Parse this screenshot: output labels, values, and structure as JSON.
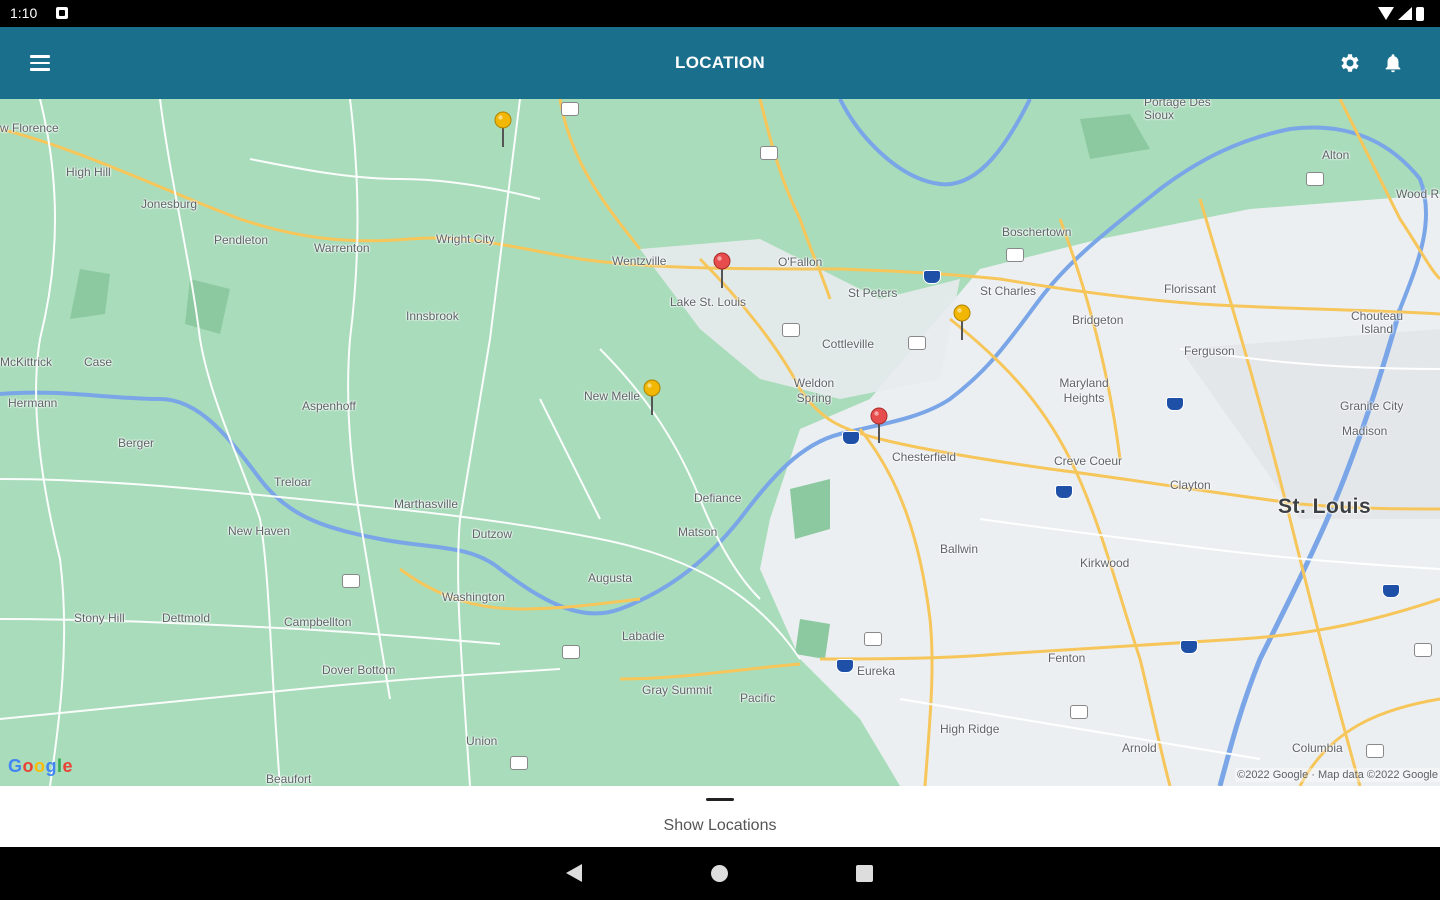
{
  "status_bar": {
    "time": "1:10"
  },
  "app_bar": {
    "title": "LOCATION"
  },
  "map": {
    "places": [
      "w Florence",
      "High Hill",
      "Jonesburg",
      "Pendleton",
      "Warrenton",
      "Wright City",
      "Wentzville",
      "O'Fallon",
      "Lake St. Louis",
      "St Peters",
      "St Charles",
      "Boschertown",
      "Portage Des Sioux",
      "Alton",
      "Wood R",
      "Florissant",
      "Bridgeton",
      "Chouteau Island",
      "Ferguson",
      "Innsbrook",
      "Cottleville",
      "Maryland Heights",
      "Granite City",
      "Madison",
      "Weldon Spring",
      "New Melle",
      "Aspenhoff",
      "Hermann",
      "Berger",
      "Treloar",
      "Marthasville",
      "Defiance",
      "Chesterfield",
      "Creve Coeur",
      "Clayton",
      "St. Louis",
      "New Haven",
      "Dutzow",
      "Matson",
      "Ballwin",
      "Kirkwood",
      "Augusta",
      "Washington",
      "Stony Hill",
      "Dettmold",
      "Campbellton",
      "Labadie",
      "Dover Bottom",
      "Gray Summit",
      "Eureka",
      "Pacific",
      "Fenton",
      "High Ridge",
      "Union",
      "Arnold",
      "Columbia",
      "Beaufort",
      "McKittrick",
      "Case"
    ],
    "attribution": "©2022 Google · Map data ©2022 Google",
    "logo": "Google",
    "pins": [
      {
        "color": "#f2b705",
        "label": "yellow-pin"
      },
      {
        "color": "#e84d4d",
        "label": "red-pin"
      },
      {
        "color": "#f2b705",
        "label": "yellow-pin"
      },
      {
        "color": "#f2b705",
        "label": "yellow-pin"
      },
      {
        "color": "#e84d4d",
        "label": "red-pin"
      }
    ]
  },
  "bottom_sheet": {
    "label": "Show Locations"
  }
}
